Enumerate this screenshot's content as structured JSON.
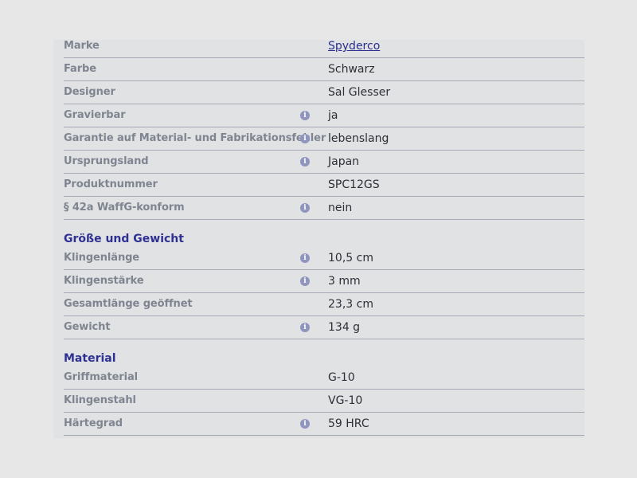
{
  "general": {
    "rows": [
      {
        "label": "Marke",
        "value": "Spyderco"
      },
      {
        "label": "Farbe",
        "value": "Schwarz"
      },
      {
        "label": "Designer",
        "value": "Sal Glesser"
      },
      {
        "label": "Gravierbar",
        "value": "ja"
      },
      {
        "label": "Garantie auf Material- und Fabrikationsfehler",
        "value": "lebenslang"
      },
      {
        "label": "Ursprungsland",
        "value": "Japan"
      },
      {
        "label": "Produktnummer",
        "value": "SPC12GS"
      },
      {
        "label": "§ 42a WaffG-konform",
        "value": "nein"
      }
    ]
  },
  "size": {
    "title": "Größe und Gewicht",
    "rows": [
      {
        "label": "Klingenlänge",
        "value": "10,5 cm"
      },
      {
        "label": "Klingenstärke",
        "value": "3 mm"
      },
      {
        "label": "Gesamtlänge geöffnet",
        "value": "23,3 cm"
      },
      {
        "label": "Gewicht",
        "value": "134 g"
      }
    ]
  },
  "material": {
    "title": "Material",
    "rows": [
      {
        "label": "Griffmaterial",
        "value": "G-10"
      },
      {
        "label": "Klingenstahl",
        "value": "VG-10"
      },
      {
        "label": "Härtegrad",
        "value": "59 HRC"
      }
    ]
  },
  "icons": {
    "info": "i"
  },
  "colors": {
    "page_background": "#e7e7e7",
    "panel_background": "#e1e2e4",
    "label": "#7f8590",
    "value": "#2c2f36",
    "section_title": "#2e3192",
    "link": "#2a2f8e",
    "info_icon": "#8f95bd",
    "divider": "#a4a9b4"
  }
}
